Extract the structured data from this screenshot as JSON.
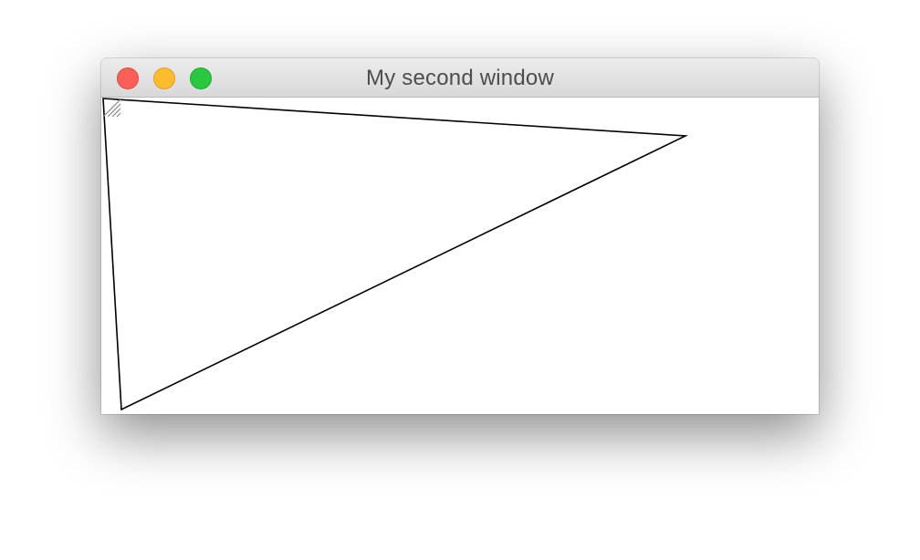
{
  "window": {
    "title": "My second window",
    "controls": {
      "close_color": "#fc5f57",
      "minimize_color": "#fdbc2e",
      "zoom_color": "#28c840"
    }
  },
  "canvas": {
    "background": "#ffffff",
    "shape": "triangle",
    "stroke_color": "#000000"
  }
}
